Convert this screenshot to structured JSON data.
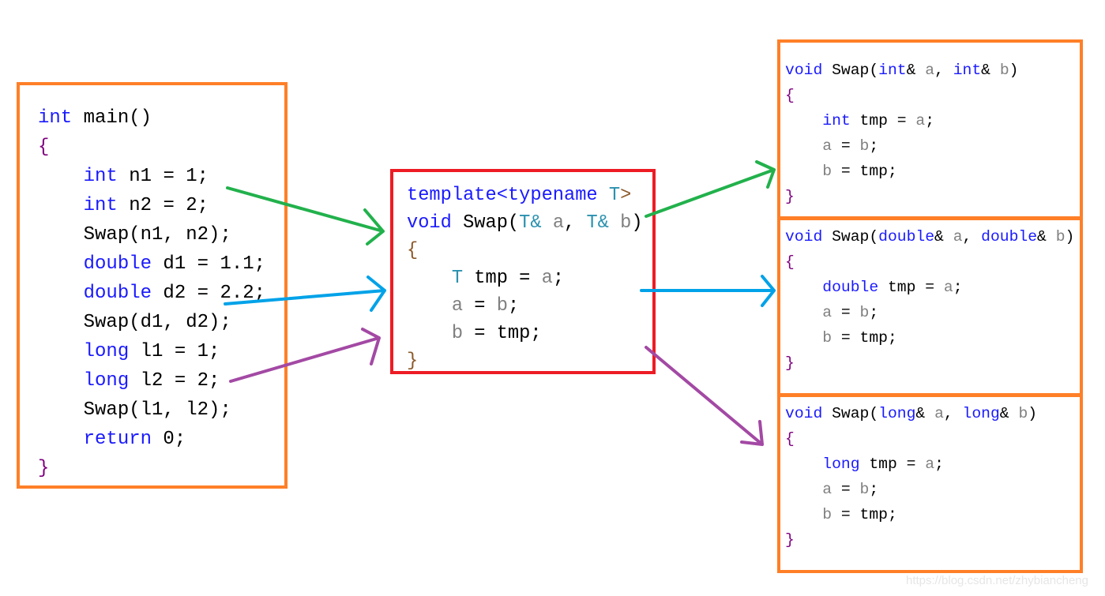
{
  "blocks": [
    {
      "id": "main-function",
      "lines": [
        [
          [
            "kw",
            "int"
          ],
          [
            "pl",
            " main()"
          ]
        ],
        [
          [
            "br",
            "{"
          ]
        ],
        [
          [
            "pl",
            "    "
          ],
          [
            "kw",
            "int"
          ],
          [
            "pl",
            " n1 = 1;"
          ]
        ],
        [
          [
            "pl",
            "    "
          ],
          [
            "kw",
            "int"
          ],
          [
            "pl",
            " n2 = 2;"
          ]
        ],
        [
          [
            "pl",
            "    Swap(n1, n2);"
          ]
        ],
        [
          [
            "pl",
            "    "
          ],
          [
            "kw",
            "double"
          ],
          [
            "pl",
            " d1 = 1.1;"
          ]
        ],
        [
          [
            "pl",
            "    "
          ],
          [
            "kw",
            "double"
          ],
          [
            "pl",
            " d2 = 2.2;"
          ]
        ],
        [
          [
            "pl",
            "    Swap(d1, d2);"
          ]
        ],
        [
          [
            "pl",
            "    "
          ],
          [
            "kw",
            "long"
          ],
          [
            "pl",
            " l1 = 1;"
          ]
        ],
        [
          [
            "pl",
            "    "
          ],
          [
            "kw",
            "long"
          ],
          [
            "pl",
            " l2 = 2;"
          ]
        ],
        [
          [
            "pl",
            "    Swap(l1, l2);"
          ]
        ],
        [
          [
            "pl",
            "    "
          ],
          [
            "kw",
            "return"
          ],
          [
            "pl",
            " 0;"
          ]
        ],
        [
          [
            "br",
            "}"
          ]
        ]
      ]
    },
    {
      "id": "template-swap",
      "lines": [
        [
          [
            "kw",
            "template<typename "
          ],
          [
            "ty",
            "T"
          ],
          [
            "br2",
            ">"
          ]
        ],
        [
          [
            "kw",
            "void"
          ],
          [
            "pl",
            " Swap("
          ],
          [
            "ty",
            "T&"
          ],
          [
            "pl",
            " "
          ],
          [
            "pa",
            "a"
          ],
          [
            "pl",
            ", "
          ],
          [
            "ty",
            "T&"
          ],
          [
            "pl",
            " "
          ],
          [
            "pa",
            "b"
          ],
          [
            "pl",
            ")"
          ]
        ],
        [
          [
            "br2",
            "{"
          ]
        ],
        [
          [
            "pl",
            "    "
          ],
          [
            "ty",
            "T"
          ],
          [
            "pl",
            " tmp = "
          ],
          [
            "pa",
            "a"
          ],
          [
            "pl",
            ";"
          ]
        ],
        [
          [
            "pl",
            "    "
          ],
          [
            "pa",
            "a"
          ],
          [
            "pl",
            " = "
          ],
          [
            "pa",
            "b"
          ],
          [
            "pl",
            ";"
          ]
        ],
        [
          [
            "pl",
            "    "
          ],
          [
            "pa",
            "b"
          ],
          [
            "pl",
            " = tmp;"
          ]
        ],
        [
          [
            "br2",
            "}"
          ]
        ]
      ]
    },
    {
      "id": "swap-int",
      "lines": [
        [
          [
            "kw",
            "void"
          ],
          [
            "pl",
            " Swap("
          ],
          [
            "kw",
            "int"
          ],
          [
            "pl",
            "& "
          ],
          [
            "pa",
            "a"
          ],
          [
            "pl",
            ", "
          ],
          [
            "kw",
            "int"
          ],
          [
            "pl",
            "& "
          ],
          [
            "pa",
            "b"
          ],
          [
            "pl",
            ")"
          ]
        ],
        [
          [
            "br",
            "{"
          ]
        ],
        [
          [
            "pl",
            "    "
          ],
          [
            "kw",
            "int"
          ],
          [
            "pl",
            " tmp = "
          ],
          [
            "pa",
            "a"
          ],
          [
            "pl",
            ";"
          ]
        ],
        [
          [
            "pl",
            "    "
          ],
          [
            "pa",
            "a"
          ],
          [
            "pl",
            " = "
          ],
          [
            "pa",
            "b"
          ],
          [
            "pl",
            ";"
          ]
        ],
        [
          [
            "pl",
            "    "
          ],
          [
            "pa",
            "b"
          ],
          [
            "pl",
            " = tmp;"
          ]
        ],
        [
          [
            "br",
            "}"
          ]
        ]
      ]
    },
    {
      "id": "swap-double",
      "lines": [
        [
          [
            "kw",
            "void"
          ],
          [
            "pl",
            " Swap("
          ],
          [
            "kw",
            "double"
          ],
          [
            "pl",
            "& "
          ],
          [
            "pa",
            "a"
          ],
          [
            "pl",
            ", "
          ],
          [
            "kw",
            "double"
          ],
          [
            "pl",
            "& "
          ],
          [
            "pa",
            "b"
          ],
          [
            "pl",
            ")"
          ]
        ],
        [
          [
            "br",
            "{"
          ]
        ],
        [
          [
            "pl",
            "    "
          ],
          [
            "kw",
            "double"
          ],
          [
            "pl",
            " tmp = "
          ],
          [
            "pa",
            "a"
          ],
          [
            "pl",
            ";"
          ]
        ],
        [
          [
            "pl",
            "    "
          ],
          [
            "pa",
            "a"
          ],
          [
            "pl",
            " = "
          ],
          [
            "pa",
            "b"
          ],
          [
            "pl",
            ";"
          ]
        ],
        [
          [
            "pl",
            "    "
          ],
          [
            "pa",
            "b"
          ],
          [
            "pl",
            " = tmp;"
          ]
        ],
        [
          [
            "br",
            "}"
          ]
        ]
      ]
    },
    {
      "id": "swap-long",
      "lines": [
        [
          [
            "kw",
            "void"
          ],
          [
            "pl",
            " Swap("
          ],
          [
            "kw",
            "long"
          ],
          [
            "pl",
            "& "
          ],
          [
            "pa",
            "a"
          ],
          [
            "pl",
            ", "
          ],
          [
            "kw",
            "long"
          ],
          [
            "pl",
            "& "
          ],
          [
            "pa",
            "b"
          ],
          [
            "pl",
            ")"
          ]
        ],
        [
          [
            "br",
            "{"
          ]
        ],
        [
          [
            "pl",
            "    "
          ],
          [
            "kw",
            "long"
          ],
          [
            "pl",
            " tmp = "
          ],
          [
            "pa",
            "a"
          ],
          [
            "pl",
            ";"
          ]
        ],
        [
          [
            "pl",
            "    "
          ],
          [
            "pa",
            "a"
          ],
          [
            "pl",
            " = "
          ],
          [
            "pa",
            "b"
          ],
          [
            "pl",
            ";"
          ]
        ],
        [
          [
            "pl",
            "    "
          ],
          [
            "pa",
            "b"
          ],
          [
            "pl",
            " = tmp;"
          ]
        ],
        [
          [
            "br",
            "}"
          ]
        ]
      ]
    }
  ],
  "colors": {
    "box_border": "#ff7f27",
    "template_border": "#ed1c24",
    "green": "#22b14c",
    "blue": "#00a2e8",
    "purple": "#a349a4"
  },
  "arrows": [
    {
      "from": "main-function",
      "to": "template-swap",
      "color": "green"
    },
    {
      "from": "main-function",
      "to": "template-swap",
      "color": "blue"
    },
    {
      "from": "main-function",
      "to": "template-swap",
      "color": "purple"
    },
    {
      "from": "template-swap",
      "to": "swap-int",
      "color": "green"
    },
    {
      "from": "template-swap",
      "to": "swap-double",
      "color": "blue"
    },
    {
      "from": "template-swap",
      "to": "swap-long",
      "color": "purple"
    }
  ],
  "watermark": "https://blog.csdn.net/zhybiancheng"
}
